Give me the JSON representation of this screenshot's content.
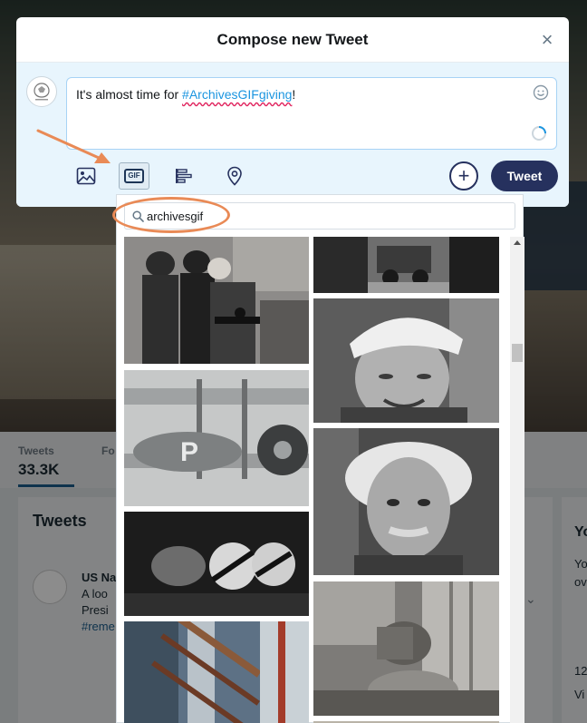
{
  "profile_background": {
    "stats": [
      {
        "label": "Tweets",
        "value": "33.3K"
      },
      {
        "label": "Fo",
        "value": ""
      }
    ],
    "tweets_heading": "Tweets",
    "tweet_preview": {
      "author": "US Na",
      "lines": [
        "A loo",
        "Presi",
        "#reme"
      ]
    },
    "right_panel_snippets": [
      "Yo",
      "Yo",
      "ov",
      "12",
      "Vi"
    ]
  },
  "compose": {
    "title": "Compose new Tweet",
    "tweet_text_prefix": "It's almost time for ",
    "tweet_hashtag": "#ArchivesGIFgiving",
    "tweet_text_suffix": "!",
    "plus_label": "+",
    "tweet_button_label": "Tweet",
    "toolbar": [
      {
        "name": "image-icon"
      },
      {
        "name": "gif-icon",
        "label": "GIF",
        "active": true
      },
      {
        "name": "poll-icon"
      },
      {
        "name": "location-icon"
      }
    ]
  },
  "gif_picker": {
    "search_value": "archivesgif",
    "tiles": [
      {
        "subject": "naval officers at microphones",
        "tone": "#8a8886"
      },
      {
        "subject": "vintage car on road",
        "tone": "#6f6f6f"
      },
      {
        "subject": "biplane close-up",
        "tone": "#b8bbbc"
      },
      {
        "subject": "boy in white cap smiling",
        "tone": "#7f7f7f"
      },
      {
        "subject": "cylinders being loaded",
        "tone": "#3a3a3a"
      },
      {
        "subject": "Einstein portrait",
        "tone": "#6a6a6a"
      },
      {
        "subject": "rocket on launch pad",
        "tone": "#6b7a88"
      },
      {
        "subject": "wooden barrels",
        "tone": "#8c8a87"
      }
    ]
  },
  "colors": {
    "accent": "#26315e",
    "annotation": "#e98a56",
    "link": "#1b95e0"
  }
}
